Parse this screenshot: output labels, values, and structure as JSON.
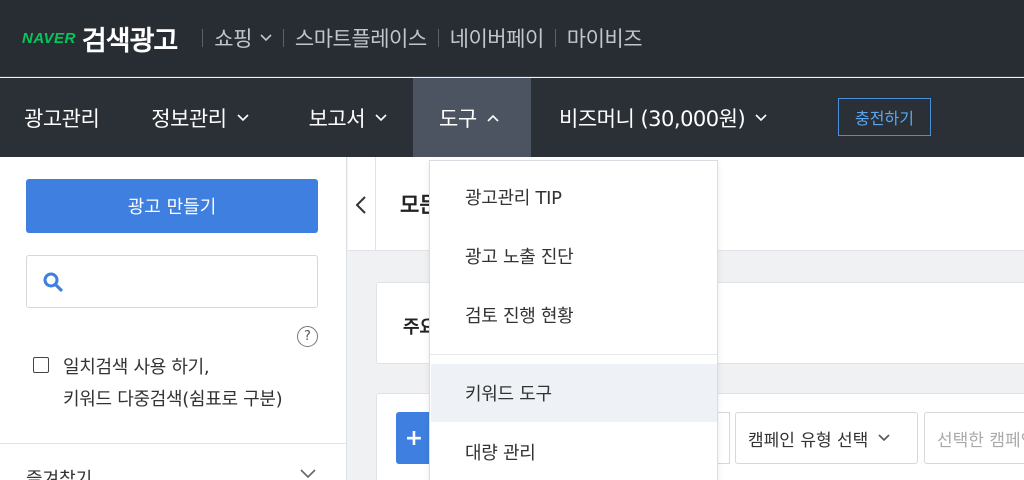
{
  "brand": {
    "naver": "NAVER",
    "title": "검색광고"
  },
  "topnav": [
    {
      "label": "쇼핑",
      "has_chevron": true
    },
    {
      "label": "스마트플레이스",
      "has_chevron": false
    },
    {
      "label": "네이버페이",
      "has_chevron": false
    },
    {
      "label": "마이비즈",
      "has_chevron": false
    }
  ],
  "mainnav": {
    "ad_manage": "광고관리",
    "info_manage": "정보관리",
    "report": "보고서",
    "tools": "도구",
    "bizmoney": "비즈머니 (30,000원)",
    "charge": "충전하기"
  },
  "sidebar": {
    "create_ad": "광고 만들기",
    "search_placeholder": "",
    "exact_line1": "일치검색 사용 하기,",
    "exact_line2": "키워드 다중검색(쉼표로 구분)",
    "favorites": "즐겨찾기",
    "help": "?"
  },
  "content": {
    "title": "모든",
    "card_label": "주요",
    "add": "+",
    "campaign_type": "캠페인 유형 선택",
    "selected_campaign": "선택한 캠페인"
  },
  "dropdown": {
    "items": [
      "광고관리 TIP",
      "광고 노출 진단",
      "검토 진행 현황",
      "키워드 도구",
      "대량 관리"
    ]
  },
  "colors": {
    "topbar": "#282d33",
    "accent": "#3e7fe0",
    "naver_green": "#03c75a",
    "active_tab": "#4c5361"
  }
}
